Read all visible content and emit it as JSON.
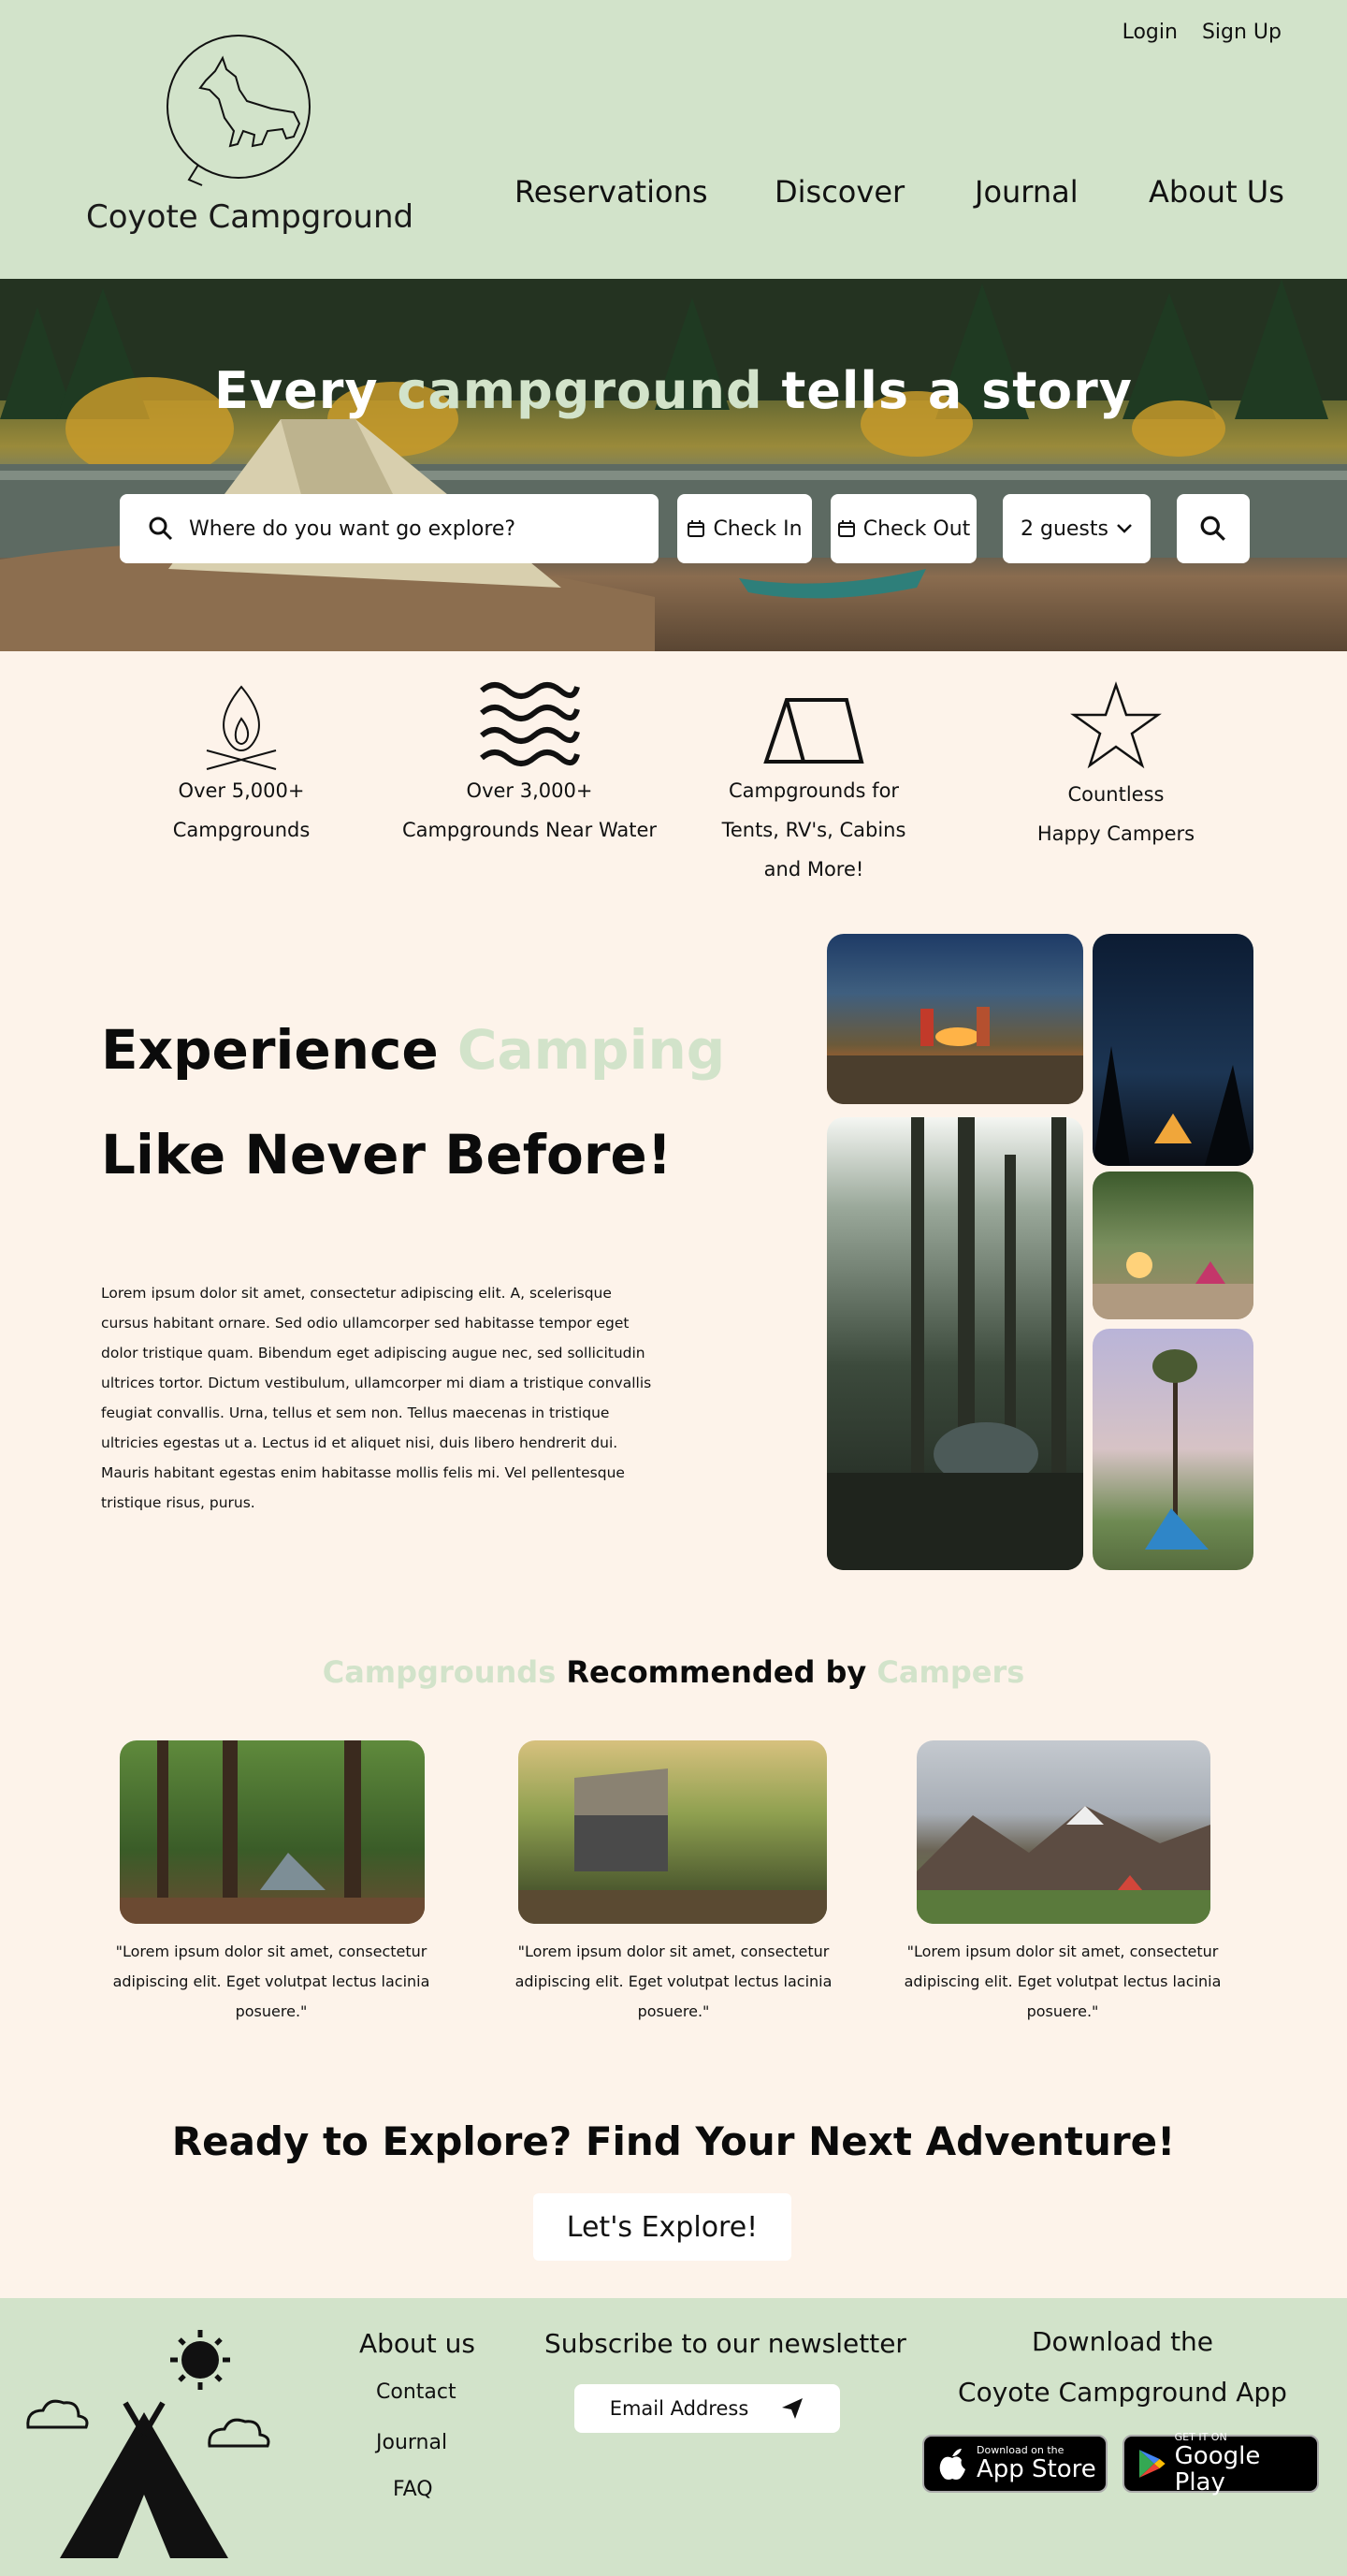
{
  "header": {
    "brand": "Coyote Campground",
    "auth": {
      "login": "Login",
      "signup": "Sign Up"
    },
    "nav": [
      "Reservations",
      "Discover",
      "Journal",
      "About Us"
    ]
  },
  "hero": {
    "title_part1": "Every ",
    "title_accent": "campground",
    "title_part2": " tells  a story",
    "search_placeholder": "Where do you want go explore?",
    "check_in": "Check In",
    "check_out": "Check Out",
    "guests": "2 guests"
  },
  "features": [
    {
      "line1": "Over 5,000+",
      "line2": "Campgrounds",
      "line3": ""
    },
    {
      "line1": "Over 3,000+",
      "line2": "Campgrounds Near Water",
      "line3": ""
    },
    {
      "line1": "Campgrounds for",
      "line2": "Tents, RV's, Cabins",
      "line3": "and More!"
    },
    {
      "line1": "Countless",
      "line2": "Happy Campers",
      "line3": ""
    }
  ],
  "experience": {
    "title_part1": "Experience ",
    "title_accent": "Camping",
    "title_line2": "Like Never Before!",
    "body": "Lorem ipsum dolor sit amet, consectetur adipiscing elit. A, scelerisque cursus habitant ornare. Sed odio ullamcorper sed habitasse tempor eget dolor tristique quam. Bibendum eget adipiscing augue nec, sed sollicitudin ultrices tortor. Dictum vestibulum, ullamcorper mi diam a tristique convallis feugiat convallis. Urna, tellus et sem non. Tellus maecenas in tristique ultricies egestas ut a. Lectus id et aliquet nisi, duis libero hendrerit dui. Mauris habitant egestas enim habitasse mollis felis mi. Vel pellentesque tristique risus, purus."
  },
  "recommended": {
    "title_accent1": "Campgrounds",
    "title_mid": " Recommended by ",
    "title_accent2": "Campers",
    "quotes": [
      "\"Lorem ipsum dolor sit amet, consectetur adipiscing elit. Eget volutpat lectus lacinia posuere.\"",
      "\"Lorem ipsum dolor sit amet, consectetur adipiscing elit. Eget volutpat lectus lacinia posuere.\"",
      "\"Lorem ipsum dolor sit amet, consectetur adipiscing elit. Eget volutpat lectus lacinia posuere.\""
    ]
  },
  "cta": {
    "title": "Ready to Explore? Find Your Next Adventure!",
    "button": "Let's Explore!"
  },
  "footer": {
    "about_heading": "About us",
    "links": [
      "Contact",
      "Journal",
      "FAQ"
    ],
    "newsletter_heading": "Subscribe to our newsletter",
    "email_placeholder": "Email Address",
    "download_line1": "Download the",
    "download_line2": "Coyote Campground App",
    "app_store_small": "Download on the",
    "app_store_big": "App Store",
    "google_small": "GET IT ON",
    "google_big": "Google Play"
  },
  "colors": {
    "accent": "#d2e3ca",
    "header_bg": "#d2e3ca",
    "page_bg": "#fdf3ea"
  }
}
